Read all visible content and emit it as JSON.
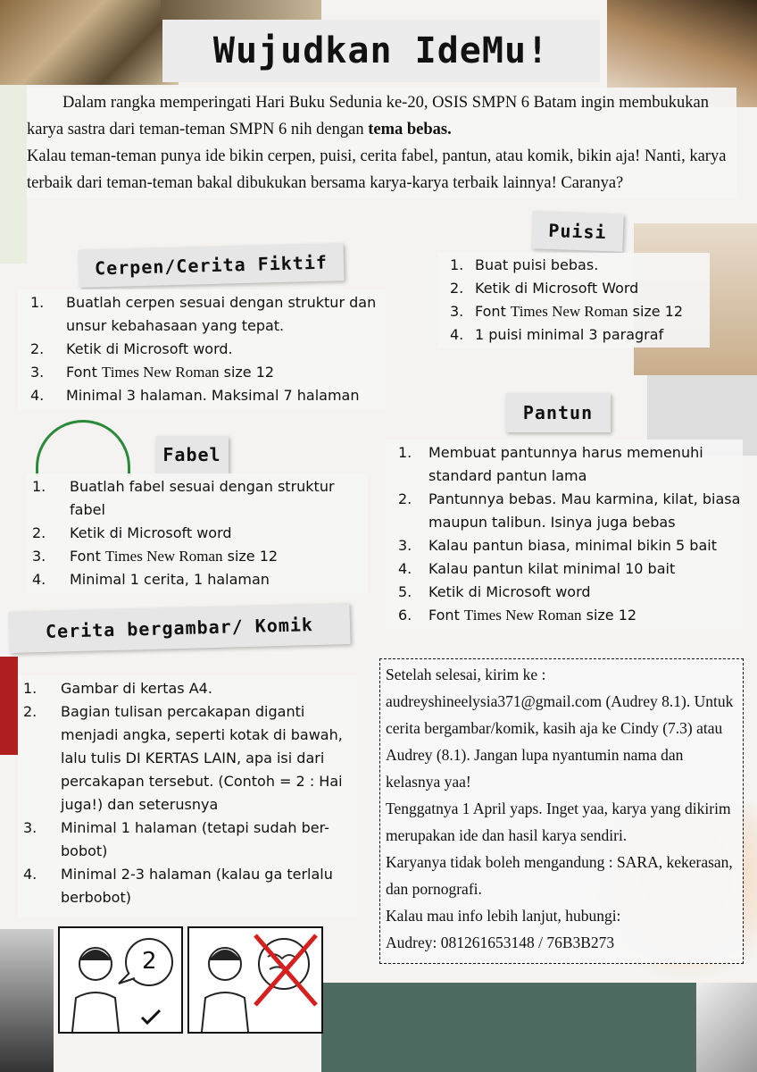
{
  "title": "Wujudkan IdeMu!",
  "intro": {
    "line1": "Dalam rangka memperingati Hari Buku Sedunia ke-20, OSIS SMPN 6 Batam ingin membukukan karya sastra dari teman-teman SMPN 6 nih dengan ",
    "bold": "tema bebas.",
    "line2": "Kalau teman-teman punya ide bikin cerpen, puisi, cerita fabel, pantun, atau komik, bikin aja! Nanti, karya terbaik dari teman-teman bakal dibukukan bersama karya-karya terbaik lainnya! Caranya?"
  },
  "cerpen": {
    "heading": "Cerpen/Cerita Fiktif",
    "items": [
      {
        "n": "1.",
        "text": "Buatlah cerpen sesuai dengan struktur dan unsur kebahasaan yang tepat."
      },
      {
        "n": "2.",
        "text": "Ketik di Microsoft word."
      },
      {
        "n": "3.",
        "pre": "Font ",
        "font": "Times New Roman",
        "post": " size 12"
      },
      {
        "n": "4.",
        "text": "Minimal 3 halaman. Maksimal 7 halaman"
      }
    ]
  },
  "puisi": {
    "heading": "Puisi",
    "items": [
      {
        "n": "1.",
        "text": "Buat puisi bebas."
      },
      {
        "n": "2.",
        "text": "Ketik di Microsoft Word"
      },
      {
        "n": "3.",
        "pre": "Font ",
        "font": "Times New Roman",
        "post": " size 12"
      },
      {
        "n": "4.",
        "text": "1 puisi minimal 3 paragraf"
      }
    ]
  },
  "fabel": {
    "heading": "Fabel",
    "items": [
      {
        "n": "1.",
        "text": "Buatlah fabel sesuai dengan struktur fabel"
      },
      {
        "n": "2.",
        "text": "Ketik di Microsoft word"
      },
      {
        "n": "3.",
        "pre": "Font ",
        "font": "Times New Roman",
        "post": " size 12"
      },
      {
        "n": "4.",
        "text": "Minimal 1 cerita, 1 halaman"
      }
    ]
  },
  "pantun": {
    "heading": "Pantun",
    "items": [
      {
        "n": "1.",
        "text": "Membuat pantunnya harus memenuhi standard pantun lama"
      },
      {
        "n": "2.",
        "text": "Pantunnya bebas. Mau karmina, kilat, biasa maupun talibun. Isinya juga bebas"
      },
      {
        "n": "3.",
        "text": "Kalau pantun biasa, minimal bikin 5 bait"
      },
      {
        "n": "4.",
        "text": "Kalau pantun kilat minimal 10 bait"
      },
      {
        "n": "5.",
        "text": "Ketik di Microsoft word"
      },
      {
        "n": "6.",
        "pre": "Font ",
        "font": "Times New Roman",
        "post": " size 12"
      }
    ]
  },
  "komik": {
    "heading": "Cerita bergambar/ Komik",
    "items": [
      {
        "n": "1.",
        "text": "Gambar di kertas A4."
      },
      {
        "n": "2.",
        "text": "Bagian tulisan percakapan diganti menjadi angka,  seperti kotak di bawah, lalu tulis DI KERTAS LAIN,  apa isi dari percakapan tersebut. (Contoh = 2 : Hai juga!) dan seterusnya"
      },
      {
        "n": "3.",
        "text": "Minimal 1 halaman (tetapi sudah ber-bobot)"
      },
      {
        "n": "4.",
        "text": "Minimal 2-3 halaman (kalau ga terlalu berbobot)"
      }
    ],
    "example_bubble": "2"
  },
  "submit": {
    "lines": [
      "Setelah selesai, kirim ke :",
      "audreyshineelysia371@gmail.com (Audrey 8.1).  Untuk cerita bergambar/komik, kasih aja ke Cindy (7.3) atau Audrey (8.1).  Jangan lupa nyantumin nama dan kelasnya yaa!",
      "Tenggatnya 1 April yaps. Inget yaa, karya yang dikirim merupakan ide dan hasil karya sendiri.",
      "Karyanya tidak boleh mengandung : SARA, kekerasan, dan pornografi.",
      "Kalau mau info lebih lanjut, hubungi:",
      "Audrey: 081261653148 / 76B3B273"
    ]
  },
  "colors": {
    "accent_red": "#d62020",
    "box_bg": "#f5f5f5",
    "heading_bg": "#e6e6e6"
  }
}
